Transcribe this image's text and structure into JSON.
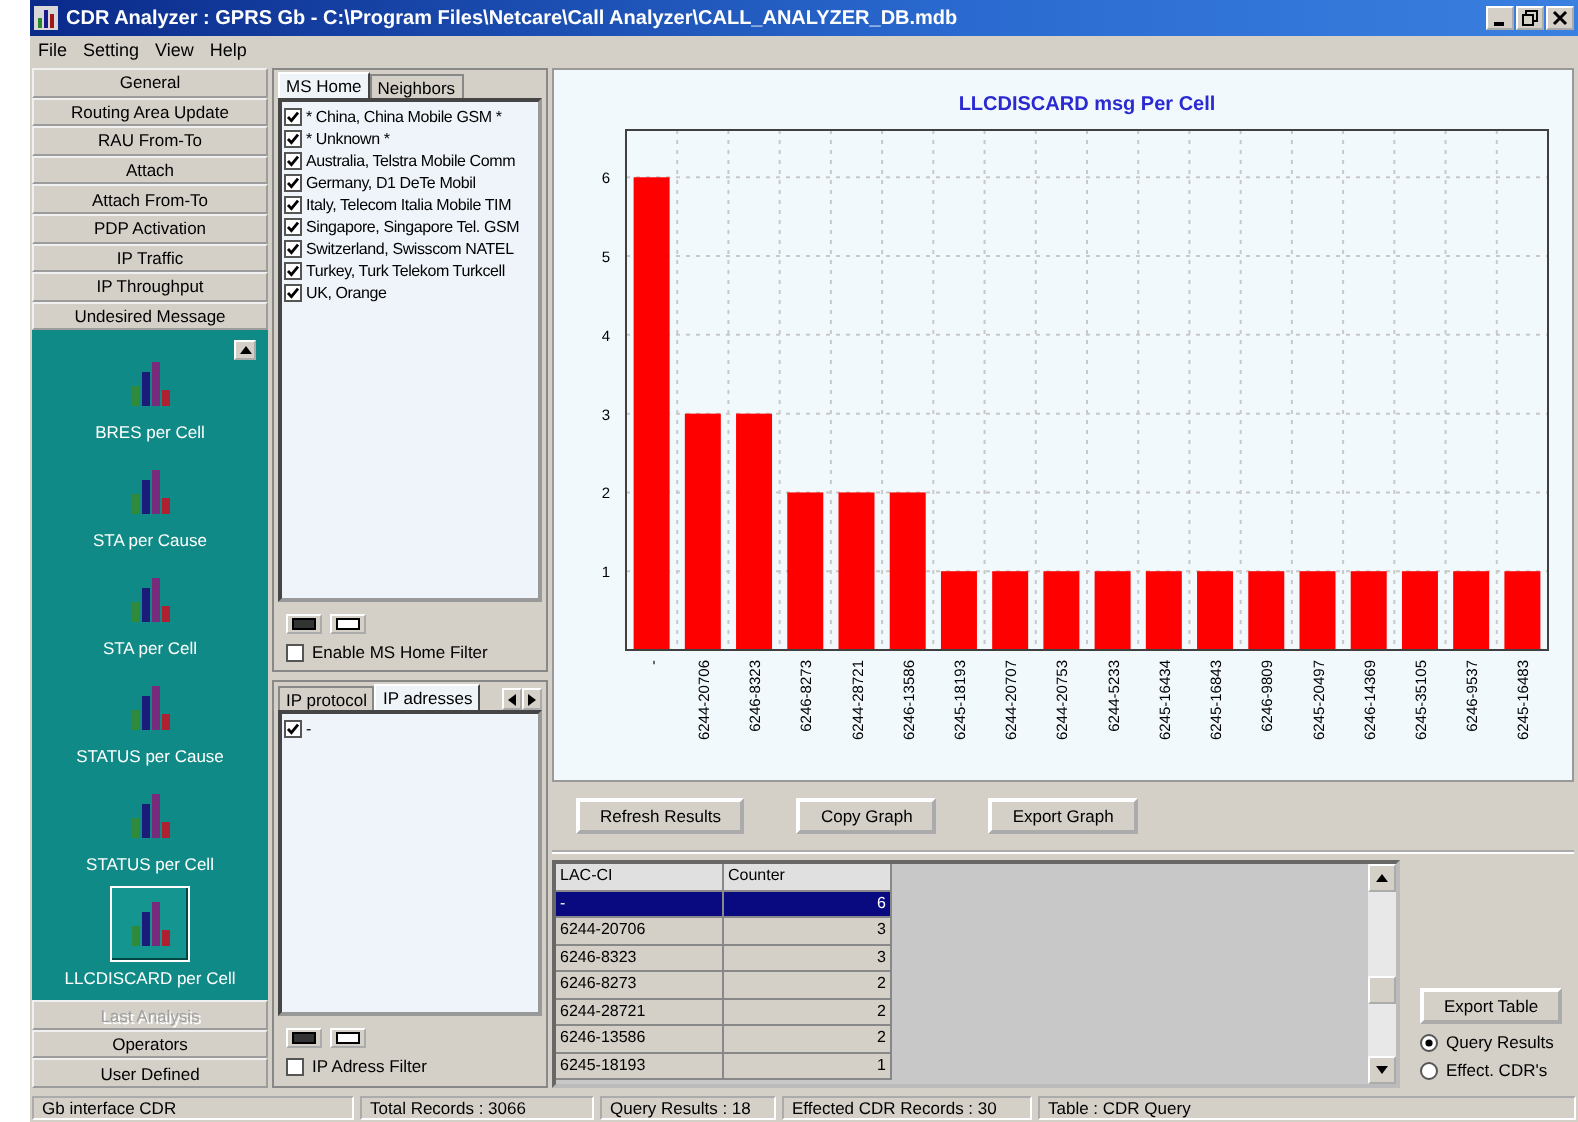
{
  "window": {
    "title": "CDR Analyzer : GPRS Gb - C:\\Program Files\\Netcare\\Call Analyzer\\CALL_ANALYZER_DB.mdb"
  },
  "menu": [
    "File",
    "Setting",
    "View",
    "Help"
  ],
  "nav": {
    "top_items": [
      {
        "label": "General"
      },
      {
        "label": "Routing Area Update"
      },
      {
        "label": "RAU From-To"
      },
      {
        "label": "Attach"
      },
      {
        "label": "Attach From-To"
      },
      {
        "label": "PDP Activation"
      },
      {
        "label": "IP Traffic"
      },
      {
        "label": "IP Throughput"
      },
      {
        "label": "Undesired Message"
      }
    ],
    "reports": [
      {
        "label": "BRES per Cell",
        "selected": false
      },
      {
        "label": "STA per Cause",
        "selected": false
      },
      {
        "label": "STA per Cell",
        "selected": false
      },
      {
        "label": "STATUS per Cause",
        "selected": false
      },
      {
        "label": "STATUS per Cell",
        "selected": false
      },
      {
        "label": "LLCDISCARD per Cell",
        "selected": true
      }
    ],
    "bottom_items": [
      {
        "label": "Last Analysis",
        "disabled": true
      },
      {
        "label": "Operators",
        "disabled": false
      },
      {
        "label": "User Defined",
        "disabled": false
      }
    ]
  },
  "ms_panel": {
    "tabs": [
      {
        "label": "MS Home",
        "selected": true
      },
      {
        "label": "Neighbors",
        "selected": false
      }
    ],
    "items": [
      {
        "label": "* China, China Mobile GSM *",
        "checked": true
      },
      {
        "label": "* Unknown *",
        "checked": true
      },
      {
        "label": "Australia, Telstra Mobile Comm",
        "checked": true
      },
      {
        "label": "Germany, D1 DeTe Mobil",
        "checked": true
      },
      {
        "label": "Italy, Telecom Italia Mobile TIM",
        "checked": true
      },
      {
        "label": "Singapore, Singapore Tel. GSM",
        "checked": true
      },
      {
        "label": "Switzerland, Swisscom NATEL",
        "checked": true
      },
      {
        "label": "Turkey, Turk Telekom Turkcell",
        "checked": true
      },
      {
        "label": "UK, Orange",
        "checked": true
      }
    ],
    "filter": {
      "label": "Enable MS Home Filter",
      "checked": false
    }
  },
  "ip_panel": {
    "tabs": [
      {
        "label": "IP protocol",
        "selected": false
      },
      {
        "label": "IP adresses",
        "selected": true
      }
    ],
    "items": [
      {
        "label": "-",
        "checked": true
      }
    ],
    "filter": {
      "label": "IP Adress Filter",
      "checked": false
    }
  },
  "chart": {
    "chart_data": {
      "type": "bar",
      "title": "LLCDISCARD msg Per Cell",
      "categories": [
        "-",
        "6244-20706",
        "6246-8323",
        "6246-8273",
        "6244-28721",
        "6246-13586",
        "6245-18193",
        "6244-20707",
        "6244-20753",
        "6244-5233",
        "6245-16434",
        "6245-16843",
        "6246-9809",
        "6245-20497",
        "6246-14369",
        "6245-35105",
        "6246-9537",
        "6245-16483"
      ],
      "values": [
        6,
        3,
        3,
        2,
        2,
        2,
        1,
        1,
        1,
        1,
        1,
        1,
        1,
        1,
        1,
        1,
        1,
        1
      ],
      "ylim": [
        0,
        6.6
      ],
      "yticks": [
        1,
        2,
        3,
        4,
        5,
        6
      ],
      "grid": true
    }
  },
  "graph_buttons": [
    "Refresh Results",
    "Copy Graph",
    "Export Graph"
  ],
  "table": {
    "columns": [
      "LAC-CI",
      "Counter"
    ],
    "rows": [
      {
        "cells": [
          "-",
          "6"
        ],
        "selected": true
      },
      {
        "cells": [
          "6244-20706",
          "3"
        ],
        "selected": false
      },
      {
        "cells": [
          "6246-8323",
          "3"
        ],
        "selected": false
      },
      {
        "cells": [
          "6246-8273",
          "2"
        ],
        "selected": false
      },
      {
        "cells": [
          "6244-28721",
          "2"
        ],
        "selected": false
      },
      {
        "cells": [
          "6246-13586",
          "2"
        ],
        "selected": false
      },
      {
        "cells": [
          "6245-18193",
          "1"
        ],
        "selected": false
      }
    ]
  },
  "export_button": "Export Table",
  "result_options": [
    {
      "label": "Query Results",
      "selected": true
    },
    {
      "label": "Effect. CDR's",
      "selected": false
    }
  ],
  "status_bar": [
    "Gb interface CDR",
    "Total Records : 3066",
    "Query Results : 18",
    "Effected CDR Records : 30",
    "Table : CDR Query"
  ]
}
